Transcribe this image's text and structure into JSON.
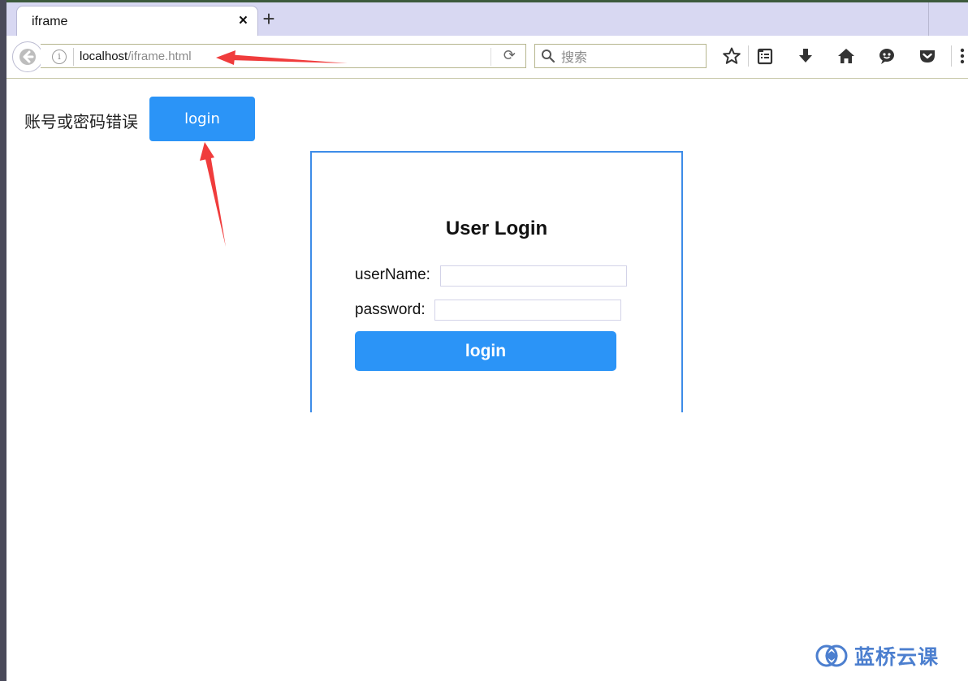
{
  "browser": {
    "tab_title": "iframe",
    "tab_close": "×",
    "new_tab": "+",
    "url_host": "localhost",
    "url_path": "/iframe.html",
    "search_placeholder": "搜索",
    "toolbar_icons": [
      "back-arrow-icon",
      "info-icon",
      "reload-icon",
      "search-icon",
      "star-icon",
      "reading-list-icon",
      "download-icon",
      "home-icon",
      "chat-icon",
      "pocket-icon",
      "menu-icon"
    ]
  },
  "page": {
    "error_message": "账号或密码错误",
    "top_login_label": "login"
  },
  "login_form": {
    "title": "User Login",
    "username_label": "userName:",
    "username_value": "",
    "password_label": "password:",
    "password_value": "",
    "submit_label": "login"
  },
  "annotations": {
    "arrow_color": "#f03c3c"
  },
  "watermark": {
    "text": "蓝桥云课"
  },
  "colors": {
    "accent": "#2b94f7",
    "iframe_border": "#3d8ce8",
    "tabstrip": "#d8d8f2"
  }
}
